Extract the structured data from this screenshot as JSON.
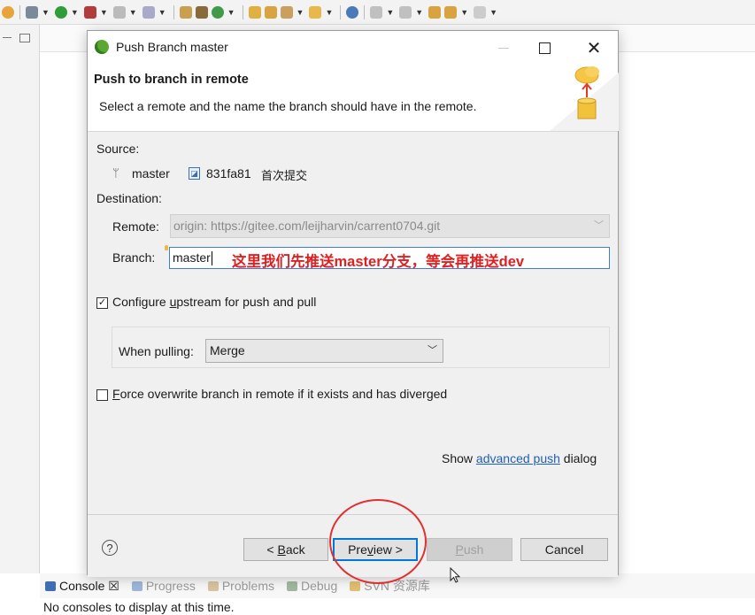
{
  "ide": {
    "toolbar_icons": [
      "debug-icon",
      "run-icon",
      "coverage-icon",
      "external-tools-icon",
      "new-class-icon",
      "open-type-icon",
      "search-icon",
      "annotation-icon",
      "toggle-mark-icon",
      "next-annotation-icon",
      "back-icon",
      "forward-icon"
    ],
    "console_tabs": [
      {
        "label": "Console ☒",
        "icon": "console-icon",
        "active": true
      },
      {
        "label": "Progress",
        "icon": "progress-icon",
        "active": false
      },
      {
        "label": "Problems",
        "icon": "problems-icon",
        "active": false
      },
      {
        "label": "Debug",
        "icon": "debug-icon",
        "active": false
      },
      {
        "label": "SVN 资源库",
        "icon": "svn-icon",
        "active": false
      }
    ],
    "console_message": "No consoles to display at this time."
  },
  "dialog": {
    "title": "Push Branch master",
    "banner_title": "Push to branch in remote",
    "banner_description": "Select a remote and the name the branch should have in the remote.",
    "source_label": "Source:",
    "source_branch": "master",
    "source_commit_id": "831fa81",
    "source_commit_message": "首次提交",
    "destination_label": "Destination:",
    "remote_label": "Remote:",
    "remote_value": "origin: https://gitee.com/leijharvin/carrent0704.git",
    "branch_label": "Branch:",
    "branch_value": "master",
    "annotation_text": "这里我们先推送master分支，等会再推送dev",
    "configure_upstream_pre": "Configure ",
    "configure_upstream_mnemonic": "u",
    "configure_upstream_post": "pstream for push and pull",
    "configure_upstream_checked": true,
    "when_pulling_label": "When pulling:",
    "when_pulling_value": "Merge",
    "force_mnemonic": "F",
    "force_post": "orce overwrite branch in remote if it exists and has diverged",
    "force_checked": false,
    "show_prefix": "Show ",
    "advanced_link": "advanced push",
    "show_suffix": " dialog",
    "buttons": {
      "back_pre": "< ",
      "back_mnemonic": "B",
      "back_post": "ack",
      "preview_pre": "Pre",
      "preview_mnemonic": "v",
      "preview_post": "iew >",
      "push_mnemonic": "P",
      "push_post": "ush",
      "cancel": "Cancel"
    },
    "help_glyph": "?",
    "close_glyph": "✕"
  },
  "colors": {
    "annotation_red": "#e02020",
    "link_blue": "#1f5fb8",
    "focus_blue": "#0078d7"
  }
}
